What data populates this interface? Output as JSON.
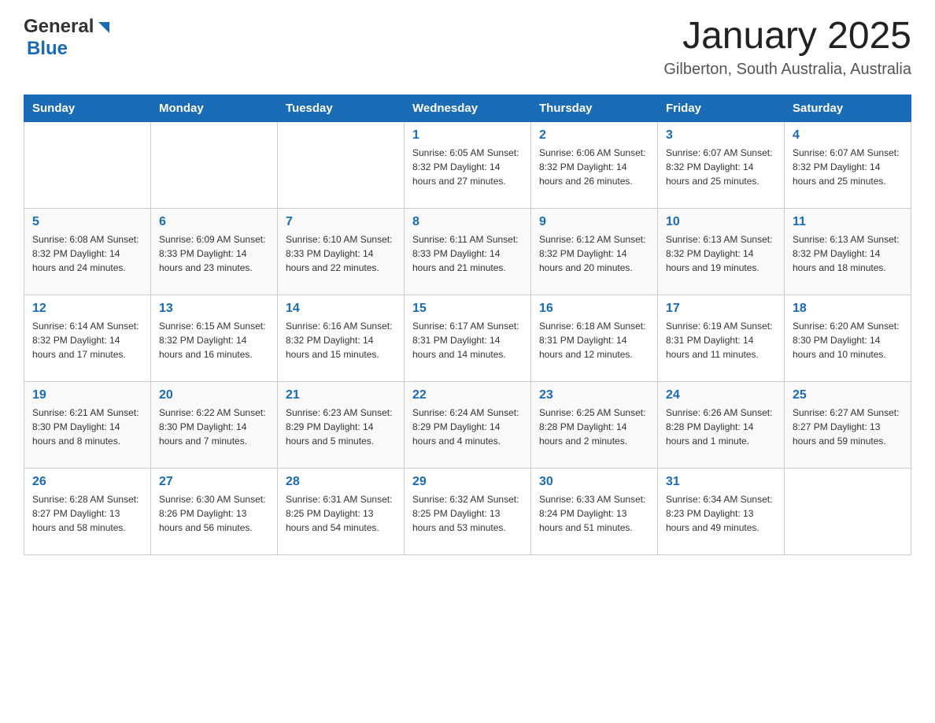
{
  "logo": {
    "text_general": "General",
    "text_blue": "Blue",
    "triangle_aria": "logo-triangle"
  },
  "header": {
    "title": "January 2025",
    "subtitle": "Gilberton, South Australia, Australia"
  },
  "weekdays": [
    "Sunday",
    "Monday",
    "Tuesday",
    "Wednesday",
    "Thursday",
    "Friday",
    "Saturday"
  ],
  "weeks": [
    [
      {
        "day": "",
        "info": ""
      },
      {
        "day": "",
        "info": ""
      },
      {
        "day": "",
        "info": ""
      },
      {
        "day": "1",
        "info": "Sunrise: 6:05 AM\nSunset: 8:32 PM\nDaylight: 14 hours and 27 minutes."
      },
      {
        "day": "2",
        "info": "Sunrise: 6:06 AM\nSunset: 8:32 PM\nDaylight: 14 hours and 26 minutes."
      },
      {
        "day": "3",
        "info": "Sunrise: 6:07 AM\nSunset: 8:32 PM\nDaylight: 14 hours and 25 minutes."
      },
      {
        "day": "4",
        "info": "Sunrise: 6:07 AM\nSunset: 8:32 PM\nDaylight: 14 hours and 25 minutes."
      }
    ],
    [
      {
        "day": "5",
        "info": "Sunrise: 6:08 AM\nSunset: 8:32 PM\nDaylight: 14 hours and 24 minutes."
      },
      {
        "day": "6",
        "info": "Sunrise: 6:09 AM\nSunset: 8:33 PM\nDaylight: 14 hours and 23 minutes."
      },
      {
        "day": "7",
        "info": "Sunrise: 6:10 AM\nSunset: 8:33 PM\nDaylight: 14 hours and 22 minutes."
      },
      {
        "day": "8",
        "info": "Sunrise: 6:11 AM\nSunset: 8:33 PM\nDaylight: 14 hours and 21 minutes."
      },
      {
        "day": "9",
        "info": "Sunrise: 6:12 AM\nSunset: 8:32 PM\nDaylight: 14 hours and 20 minutes."
      },
      {
        "day": "10",
        "info": "Sunrise: 6:13 AM\nSunset: 8:32 PM\nDaylight: 14 hours and 19 minutes."
      },
      {
        "day": "11",
        "info": "Sunrise: 6:13 AM\nSunset: 8:32 PM\nDaylight: 14 hours and 18 minutes."
      }
    ],
    [
      {
        "day": "12",
        "info": "Sunrise: 6:14 AM\nSunset: 8:32 PM\nDaylight: 14 hours and 17 minutes."
      },
      {
        "day": "13",
        "info": "Sunrise: 6:15 AM\nSunset: 8:32 PM\nDaylight: 14 hours and 16 minutes."
      },
      {
        "day": "14",
        "info": "Sunrise: 6:16 AM\nSunset: 8:32 PM\nDaylight: 14 hours and 15 minutes."
      },
      {
        "day": "15",
        "info": "Sunrise: 6:17 AM\nSunset: 8:31 PM\nDaylight: 14 hours and 14 minutes."
      },
      {
        "day": "16",
        "info": "Sunrise: 6:18 AM\nSunset: 8:31 PM\nDaylight: 14 hours and 12 minutes."
      },
      {
        "day": "17",
        "info": "Sunrise: 6:19 AM\nSunset: 8:31 PM\nDaylight: 14 hours and 11 minutes."
      },
      {
        "day": "18",
        "info": "Sunrise: 6:20 AM\nSunset: 8:30 PM\nDaylight: 14 hours and 10 minutes."
      }
    ],
    [
      {
        "day": "19",
        "info": "Sunrise: 6:21 AM\nSunset: 8:30 PM\nDaylight: 14 hours and 8 minutes."
      },
      {
        "day": "20",
        "info": "Sunrise: 6:22 AM\nSunset: 8:30 PM\nDaylight: 14 hours and 7 minutes."
      },
      {
        "day": "21",
        "info": "Sunrise: 6:23 AM\nSunset: 8:29 PM\nDaylight: 14 hours and 5 minutes."
      },
      {
        "day": "22",
        "info": "Sunrise: 6:24 AM\nSunset: 8:29 PM\nDaylight: 14 hours and 4 minutes."
      },
      {
        "day": "23",
        "info": "Sunrise: 6:25 AM\nSunset: 8:28 PM\nDaylight: 14 hours and 2 minutes."
      },
      {
        "day": "24",
        "info": "Sunrise: 6:26 AM\nSunset: 8:28 PM\nDaylight: 14 hours and 1 minute."
      },
      {
        "day": "25",
        "info": "Sunrise: 6:27 AM\nSunset: 8:27 PM\nDaylight: 13 hours and 59 minutes."
      }
    ],
    [
      {
        "day": "26",
        "info": "Sunrise: 6:28 AM\nSunset: 8:27 PM\nDaylight: 13 hours and 58 minutes."
      },
      {
        "day": "27",
        "info": "Sunrise: 6:30 AM\nSunset: 8:26 PM\nDaylight: 13 hours and 56 minutes."
      },
      {
        "day": "28",
        "info": "Sunrise: 6:31 AM\nSunset: 8:25 PM\nDaylight: 13 hours and 54 minutes."
      },
      {
        "day": "29",
        "info": "Sunrise: 6:32 AM\nSunset: 8:25 PM\nDaylight: 13 hours and 53 minutes."
      },
      {
        "day": "30",
        "info": "Sunrise: 6:33 AM\nSunset: 8:24 PM\nDaylight: 13 hours and 51 minutes."
      },
      {
        "day": "31",
        "info": "Sunrise: 6:34 AM\nSunset: 8:23 PM\nDaylight: 13 hours and 49 minutes."
      },
      {
        "day": "",
        "info": ""
      }
    ]
  ]
}
